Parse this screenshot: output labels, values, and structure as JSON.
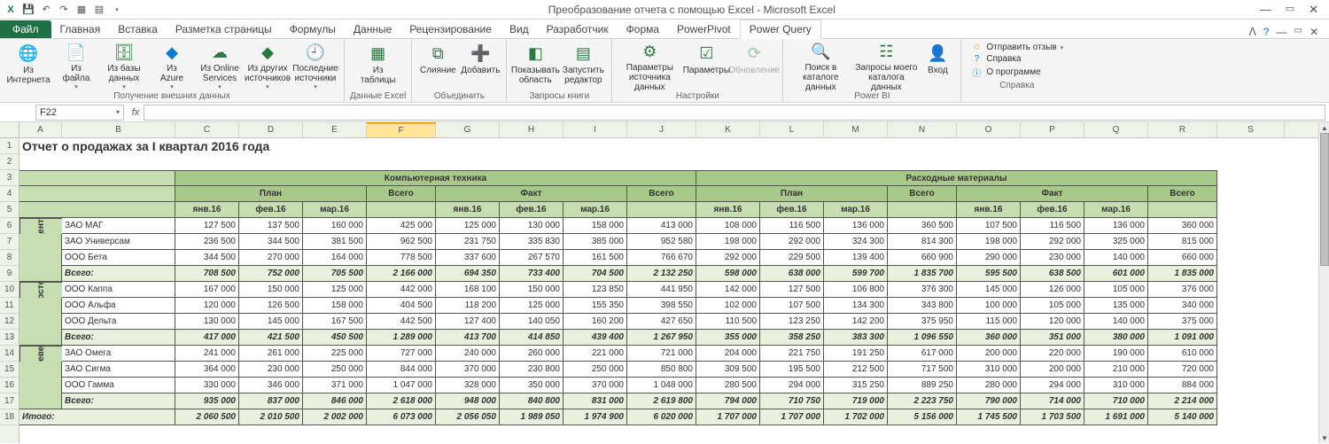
{
  "window": {
    "title": "Преобразование отчета с помощью Excel - Microsoft Excel",
    "minimize": "—",
    "restore": "▭",
    "close": "✕"
  },
  "qat": {
    "excel": "X",
    "save": "💾",
    "undo": "↶",
    "redo": "↷",
    "ext1": "▦",
    "ext2": "▤"
  },
  "tabs": {
    "file": "Файл",
    "home": "Главная",
    "insert": "Вставка",
    "layout": "Разметка страницы",
    "formulas": "Формулы",
    "data": "Данные",
    "review": "Рецензирование",
    "view": "Вид",
    "developer": "Разработчик",
    "form": "Форма",
    "powerpivot": "PowerPivot",
    "powerquery": "Power Query"
  },
  "ribbon_right": {
    "collapse": "ᐱ",
    "help": "?",
    "min": "—",
    "restore": "▭",
    "close": "✕"
  },
  "ribbon": {
    "external": {
      "internet": "Из\nИнтернета",
      "file": "Из\nфайла",
      "db": "Из базы\nданных",
      "azure": "Из\nAzure",
      "online": "Из Online\nServices",
      "other": "Из других\nисточников",
      "recent": "Последние\nисточники",
      "label": "Получение внешних данных"
    },
    "excel": {
      "table": "Из\nтаблицы",
      "label": "Данные Excel"
    },
    "combine": {
      "merge": "Слияние",
      "append": "Добавить",
      "label": "Объединить"
    },
    "book": {
      "show": "Показывать\nобласть",
      "launch": "Запустить\nредактор",
      "label": "Запросы книги"
    },
    "settings": {
      "src": "Параметры\nисточника данных",
      "opt": "Параметры",
      "upd": "Обновление",
      "label": "Настройки"
    },
    "powerbi": {
      "search": "Поиск в\nкаталоге данных",
      "my": "Запросы моего\nкаталога данных",
      "login": "Вход",
      "label": "Power BI"
    },
    "help": {
      "feedback": "Отправить отзыв",
      "ref": "Справка",
      "about": "О программе",
      "label": "Справка"
    }
  },
  "namebox": "F22",
  "fx": "fx",
  "columns": [
    "A",
    "B",
    "C",
    "D",
    "E",
    "F",
    "G",
    "H",
    "I",
    "J",
    "K",
    "L",
    "M",
    "N",
    "O",
    "P",
    "Q",
    "R",
    "S"
  ],
  "rows": [
    "1",
    "2",
    "3",
    "4",
    "5",
    "6",
    "7",
    "8",
    "9",
    "10",
    "11",
    "12",
    "13",
    "14",
    "15",
    "16",
    "17",
    "18"
  ],
  "chart_data": {
    "type": "table",
    "title": "Отчет о продажах за I квартал 2016 года",
    "section1": "Компьютерная техника",
    "section2": "Расходные материалы",
    "plan": "План",
    "fact": "Факт",
    "total": "Всего",
    "months": [
      "янв.16",
      "фев.16",
      "мар.16"
    ],
    "subtotal": "Всего:",
    "grand": "Итого:",
    "regions": [
      {
        "name": "Центр",
        "rows": [
          {
            "company": "ЗАО МАГ",
            "s1p": [
              127500,
              137500,
              160000,
              425000
            ],
            "s1f": [
              125000,
              130000,
              158000,
              413000
            ],
            "s2p": [
              108000,
              116500,
              136000,
              360500
            ],
            "s2f": [
              107500,
              116500,
              136000,
              360000
            ]
          },
          {
            "company": "ЗАО Универсам",
            "s1p": [
              236500,
              344500,
              381500,
              962500
            ],
            "s1f": [
              231750,
              335830,
              385000,
              952580
            ],
            "s2p": [
              198000,
              292000,
              324300,
              814300
            ],
            "s2f": [
              198000,
              292000,
              325000,
              815000
            ]
          },
          {
            "company": "ООО Бета",
            "s1p": [
              344500,
              270000,
              164000,
              778500
            ],
            "s1f": [
              337600,
              267570,
              161500,
              766670
            ],
            "s2p": [
              292000,
              229500,
              139400,
              660900
            ],
            "s2f": [
              290000,
              230000,
              140000,
              660000
            ]
          }
        ],
        "subtotal": {
          "s1p": [
            708500,
            752000,
            705500,
            2166000
          ],
          "s1f": [
            694350,
            733400,
            704500,
            2132250
          ],
          "s2p": [
            598000,
            638000,
            599700,
            1835700
          ],
          "s2f": [
            595500,
            638500,
            601000,
            1835000
          ]
        }
      },
      {
        "name": "Восток",
        "rows": [
          {
            "company": "ООО Каппа",
            "s1p": [
              167000,
              150000,
              125000,
              442000
            ],
            "s1f": [
              168100,
              150000,
              123850,
              441950
            ],
            "s2p": [
              142000,
              127500,
              106800,
              376300
            ],
            "s2f": [
              145000,
              126000,
              105000,
              376000
            ]
          },
          {
            "company": "ООО Альфа",
            "s1p": [
              120000,
              126500,
              158000,
              404500
            ],
            "s1f": [
              118200,
              125000,
              155350,
              398550
            ],
            "s2p": [
              102000,
              107500,
              134300,
              343800
            ],
            "s2f": [
              100000,
              105000,
              135000,
              340000
            ]
          },
          {
            "company": "ООО Дельта",
            "s1p": [
              130000,
              145000,
              167500,
              442500
            ],
            "s1f": [
              127400,
              140050,
              160200,
              427650
            ],
            "s2p": [
              110500,
              123250,
              142200,
              375950
            ],
            "s2f": [
              115000,
              120000,
              140000,
              375000
            ]
          }
        ],
        "subtotal": {
          "s1p": [
            417000,
            421500,
            450500,
            1289000
          ],
          "s1f": [
            413700,
            414850,
            439400,
            1267950
          ],
          "s2p": [
            355000,
            358250,
            383300,
            1096550
          ],
          "s2f": [
            360000,
            351000,
            380000,
            1091000
          ]
        }
      },
      {
        "name": "Север",
        "rows": [
          {
            "company": "ЗАО Омега",
            "s1p": [
              241000,
              261000,
              225000,
              727000
            ],
            "s1f": [
              240000,
              260000,
              221000,
              721000
            ],
            "s2p": [
              204000,
              221750,
              191250,
              617000
            ],
            "s2f": [
              200000,
              220000,
              190000,
              610000
            ]
          },
          {
            "company": "ЗАО Сигма",
            "s1p": [
              364000,
              230000,
              250000,
              844000
            ],
            "s1f": [
              370000,
              230800,
              250000,
              850800
            ],
            "s2p": [
              309500,
              195500,
              212500,
              717500
            ],
            "s2f": [
              310000,
              200000,
              210000,
              720000
            ]
          },
          {
            "company": "ООО Гамма",
            "s1p": [
              330000,
              346000,
              371000,
              1047000
            ],
            "s1f": [
              328000,
              350000,
              370000,
              1048000
            ],
            "s2p": [
              280500,
              294000,
              315250,
              889250
            ],
            "s2f": [
              280000,
              294000,
              310000,
              884000
            ]
          }
        ],
        "subtotal": {
          "s1p": [
            935000,
            837000,
            846000,
            2618000
          ],
          "s1f": [
            948000,
            840800,
            831000,
            2619800
          ],
          "s2p": [
            794000,
            710750,
            719000,
            2223750
          ],
          "s2f": [
            790000,
            714000,
            710000,
            2214000
          ]
        }
      }
    ],
    "grand_total": {
      "s1p": [
        2060500,
        2010500,
        2002000,
        6073000
      ],
      "s1f": [
        2056050,
        1989050,
        1974900,
        6020000
      ],
      "s2p": [
        1707000,
        1707000,
        1702000,
        5156000
      ],
      "s2f": [
        1745500,
        1703500,
        1691000,
        5140000
      ]
    }
  }
}
